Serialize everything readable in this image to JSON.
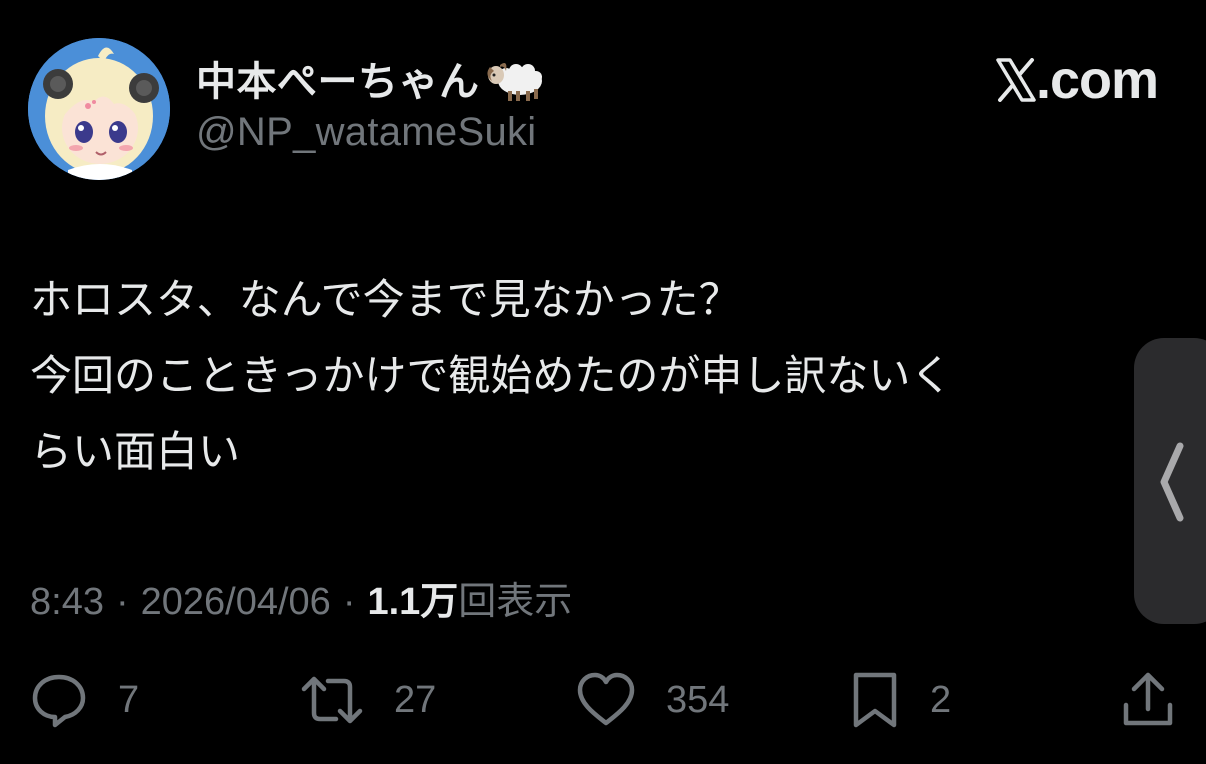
{
  "user": {
    "display_name": "中本ぺーちゃん",
    "handle": "@NP_watameSuki",
    "name_emoji": "sheep-icon"
  },
  "brand": {
    "logo_text": ".com",
    "logo_icon": "x-logo-icon"
  },
  "tweet": {
    "line1": "ホロスタ、なんで今まで見なかった？",
    "line2": "今回のこときっかけで観始めたのが申し訳ないく",
    "line3": "らい面白い"
  },
  "meta": {
    "time": "8:43",
    "separator1": "·",
    "date": "2026/04/06",
    "separator2": "·",
    "views_count": "1.1万",
    "views_label": "回表示"
  },
  "actions": {
    "reply_count": "7",
    "retweet_count": "27",
    "like_count": "354",
    "bookmark_count": "2"
  },
  "colors": {
    "background": "#000000",
    "primary_text": "#e7e9ea",
    "secondary_text": "#71767b",
    "side_tab": "#2b2b2d"
  }
}
